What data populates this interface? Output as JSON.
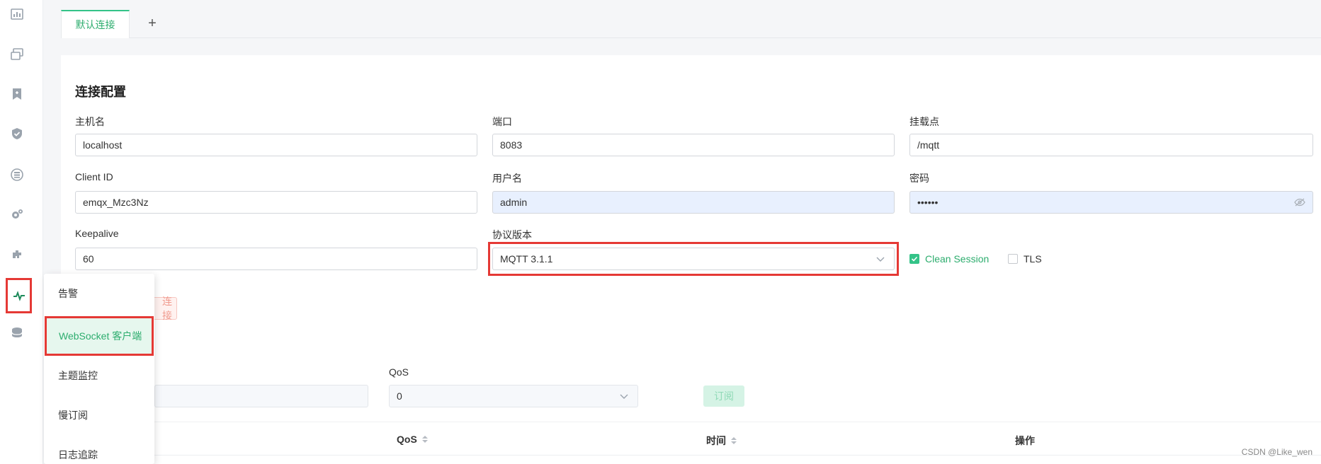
{
  "tabs": {
    "active_label": "默认连接",
    "add_symbol": "+"
  },
  "connection": {
    "section_title": "连接配置",
    "host_label": "主机名",
    "host_value": "localhost",
    "port_label": "端口",
    "port_value": "8083",
    "mount_label": "挂载点",
    "mount_value": "/mqtt",
    "clientid_label": "Client ID",
    "clientid_value": "emqx_Mzc3Nz",
    "username_label": "用户名",
    "username_value": "admin",
    "password_label": "密码",
    "password_value": "••••••",
    "keepalive_label": "Keepalive",
    "keepalive_value": "60",
    "protocol_label": "协议版本",
    "protocol_value": "MQTT 3.1.1",
    "clean_session_label": "Clean Session",
    "clean_session_checked": true,
    "tls_label": "TLS",
    "tls_checked": false,
    "connect_button_label": "连接"
  },
  "subscribe": {
    "qos_label": "QoS",
    "qos_value": "0",
    "subscribe_button_label": "订阅"
  },
  "table": {
    "columns": [
      "QoS",
      "时间",
      "操作"
    ]
  },
  "flyout_menu": {
    "items": [
      {
        "label": "告警",
        "selected": false
      },
      {
        "label": "WebSocket 客户端",
        "selected": true
      },
      {
        "label": "主题监控",
        "selected": false
      },
      {
        "label": "慢订阅",
        "selected": false
      },
      {
        "label": "日志追踪",
        "selected": false
      }
    ]
  },
  "rail_icons": [
    "dashboard-icon",
    "clients-icon",
    "subscriptions-icon",
    "security-icon",
    "data-integration-icon",
    "management-icon",
    "plugins-icon",
    "diagnose-icon",
    "extensions-icon"
  ],
  "watermark": "CSDN @Like_wen",
  "colors": {
    "accent": "#34c388",
    "highlight_frame": "#e53935"
  }
}
